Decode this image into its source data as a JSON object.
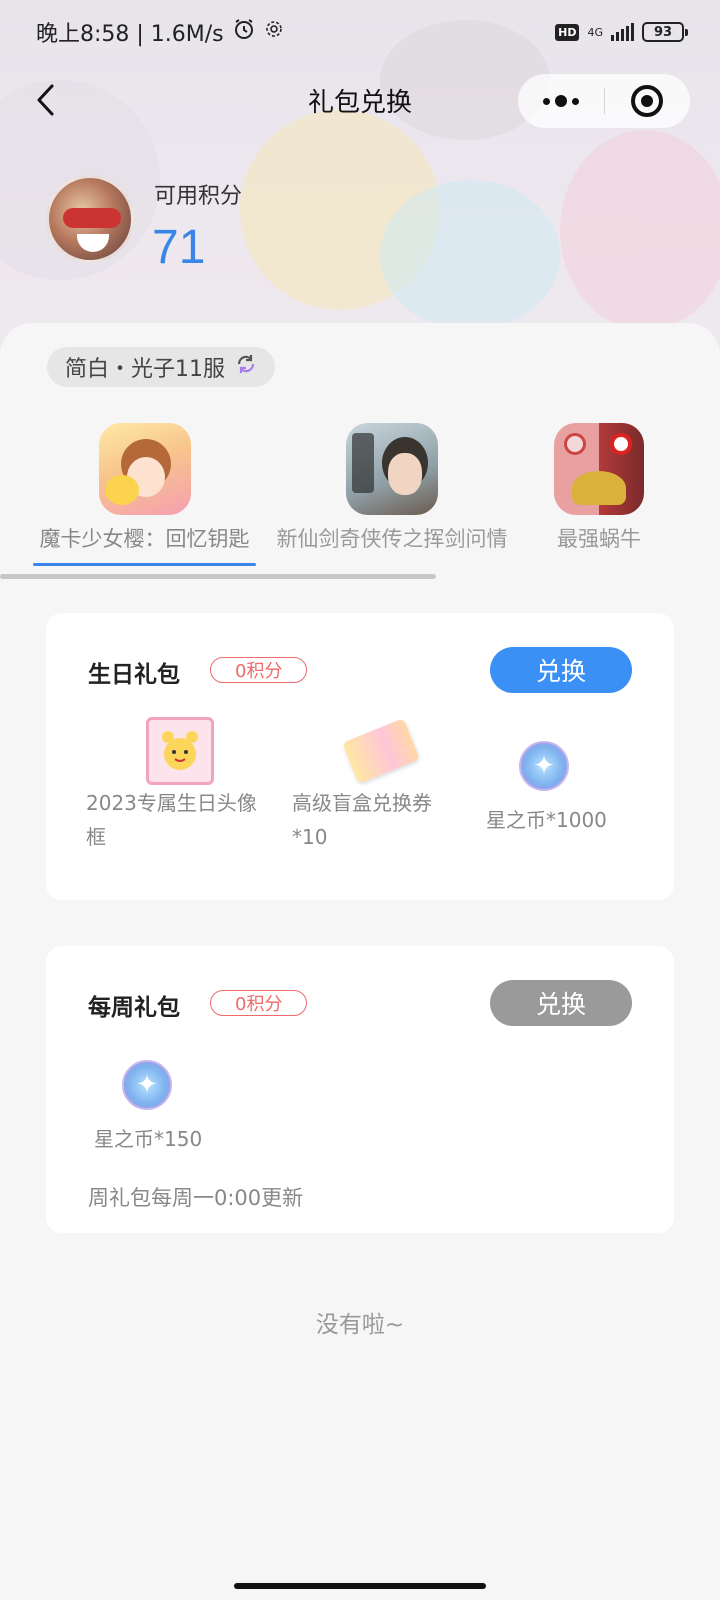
{
  "status_bar": {
    "time_speed": "晚上8:58 | 1.6M/s",
    "hd": "HD",
    "network": "4G",
    "battery": "93"
  },
  "nav": {
    "title": "礼包兑换",
    "back_icon": "chevron-left-icon",
    "more_icon": "more-dots-icon",
    "close_icon": "target-circle-icon"
  },
  "points": {
    "label": "可用积分",
    "value": "71"
  },
  "server": {
    "label": "简白・光子11服",
    "icon": "refresh-icon"
  },
  "games": [
    {
      "name": "魔卡少女樱：回忆钥匙",
      "active": true
    },
    {
      "name": "新仙剑奇侠传之挥剑问情",
      "active": false
    },
    {
      "name": "最强蜗牛",
      "active": false
    }
  ],
  "packages": [
    {
      "title": "生日礼包",
      "cost": "0积分",
      "button": "兑换",
      "button_state": "active",
      "rewards": [
        {
          "line1": "2023专属生日头像",
          "line2": "框",
          "icon": "avatar-frame-icon"
        },
        {
          "line1": "高级盲盒兑换券",
          "line2": "*10",
          "icon": "ticket-icon"
        },
        {
          "line1": "星之币*1000",
          "line2": "",
          "icon": "star-coin-icon"
        }
      ]
    },
    {
      "title": "每周礼包",
      "cost": "0积分",
      "button": "兑换",
      "button_state": "disabled",
      "rewards": [
        {
          "line1": "星之币*150",
          "line2": "",
          "icon": "star-coin-icon"
        }
      ],
      "note": "周礼包每周一0:00更新"
    }
  ],
  "end_text": "没有啦~",
  "colors": {
    "accent": "#3a86e8",
    "cost": "#ee6b6b",
    "disabled": "#9a9a9a"
  }
}
